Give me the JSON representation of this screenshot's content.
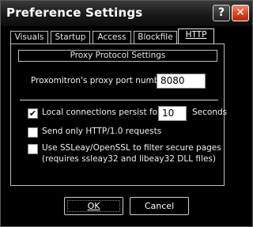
{
  "window": {
    "title": "Preference Settings",
    "help_glyph": "?",
    "close_glyph": "✕"
  },
  "tabs": [
    {
      "label": "Visuals",
      "active": false
    },
    {
      "label": "Startup",
      "active": false
    },
    {
      "label": "Access",
      "active": false
    },
    {
      "label": "Blockfile",
      "active": false
    },
    {
      "label": "HTTP",
      "active": true
    }
  ],
  "proxy": {
    "group_title": "Proxy Protocol Settings",
    "port_label": "Proxomitron's proxy port number:",
    "port_value": "8080"
  },
  "options": {
    "persist_label": "Local connections persist for:",
    "persist_checked": true,
    "persist_value": "10",
    "persist_unit": "Seconds",
    "http10_label": "Send only HTTP/1.0 requests",
    "http10_checked": false,
    "ssl_label_line1": "Use SSLeay/OpenSSL to filter secure pages",
    "ssl_label_line2": "(requires ssleay32 and libeay32 DLL files)",
    "ssl_checked": false
  },
  "buttons": {
    "ok_label": "OK",
    "cancel_label": "Cancel"
  }
}
